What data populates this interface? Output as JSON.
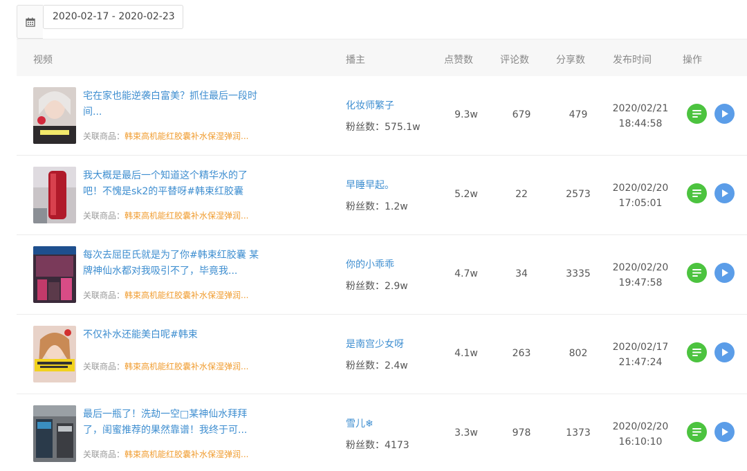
{
  "date_range": {
    "value": "2020-02-17 - 2020-02-23"
  },
  "table": {
    "headers": {
      "video": "视频",
      "author": "播主",
      "likes": "点赞数",
      "comments": "评论数",
      "shares": "分享数",
      "publish_time": "发布时间",
      "actions": "操作"
    },
    "product_label": "关联商品：",
    "rows": [
      {
        "title": "宅在家也能逆袭白富美？抓住最后一段时间...",
        "product": "韩束高机能红胶囊补水保湿弹润...",
        "author": "化妆师繁子",
        "fans": "粉丝数：575.1w",
        "likes": "9.3w",
        "comments": "679",
        "shares": "479",
        "date": "2020/02/21",
        "time": "18:44:58"
      },
      {
        "title": "我大概是最后一个知道这个精华水的了吧！不愧是sk2的平替呀#韩束红胶囊",
        "product": "韩束高机能红胶囊补水保湿弹润...",
        "author": "早睡早起。",
        "fans": "粉丝数：1.2w",
        "likes": "5.2w",
        "comments": "22",
        "shares": "2573",
        "date": "2020/02/20",
        "time": "17:05:01"
      },
      {
        "title": "每次去屈臣氏就是为了你#韩束红胶囊 某牌神仙水都对我吸引不了，毕竟我...",
        "product": "韩束高机能红胶囊补水保湿弹润...",
        "author": "你的小乖乖",
        "fans": "粉丝数：2.9w",
        "likes": "4.7w",
        "comments": "34",
        "shares": "3335",
        "date": "2020/02/20",
        "time": "19:47:58"
      },
      {
        "title": "不仅补水还能美白呢#韩束",
        "product": "韩束高机能红胶囊补水保湿弹润...",
        "author": "是南宫少女呀",
        "fans": "粉丝数：2.4w",
        "likes": "4.1w",
        "comments": "263",
        "shares": "802",
        "date": "2020/02/17",
        "time": "21:47:24"
      },
      {
        "title": "最后一瓶了！洗劫一空□某神仙水拜拜了，闺蜜推荐的果然靠谱！我终于可...",
        "product": "韩束高机能红胶囊补水保湿弹润...",
        "author": "雪儿❄",
        "fans": "粉丝数：4173",
        "likes": "3.3w",
        "comments": "978",
        "shares": "1373",
        "date": "2020/02/20",
        "time": "16:10:10"
      }
    ]
  }
}
